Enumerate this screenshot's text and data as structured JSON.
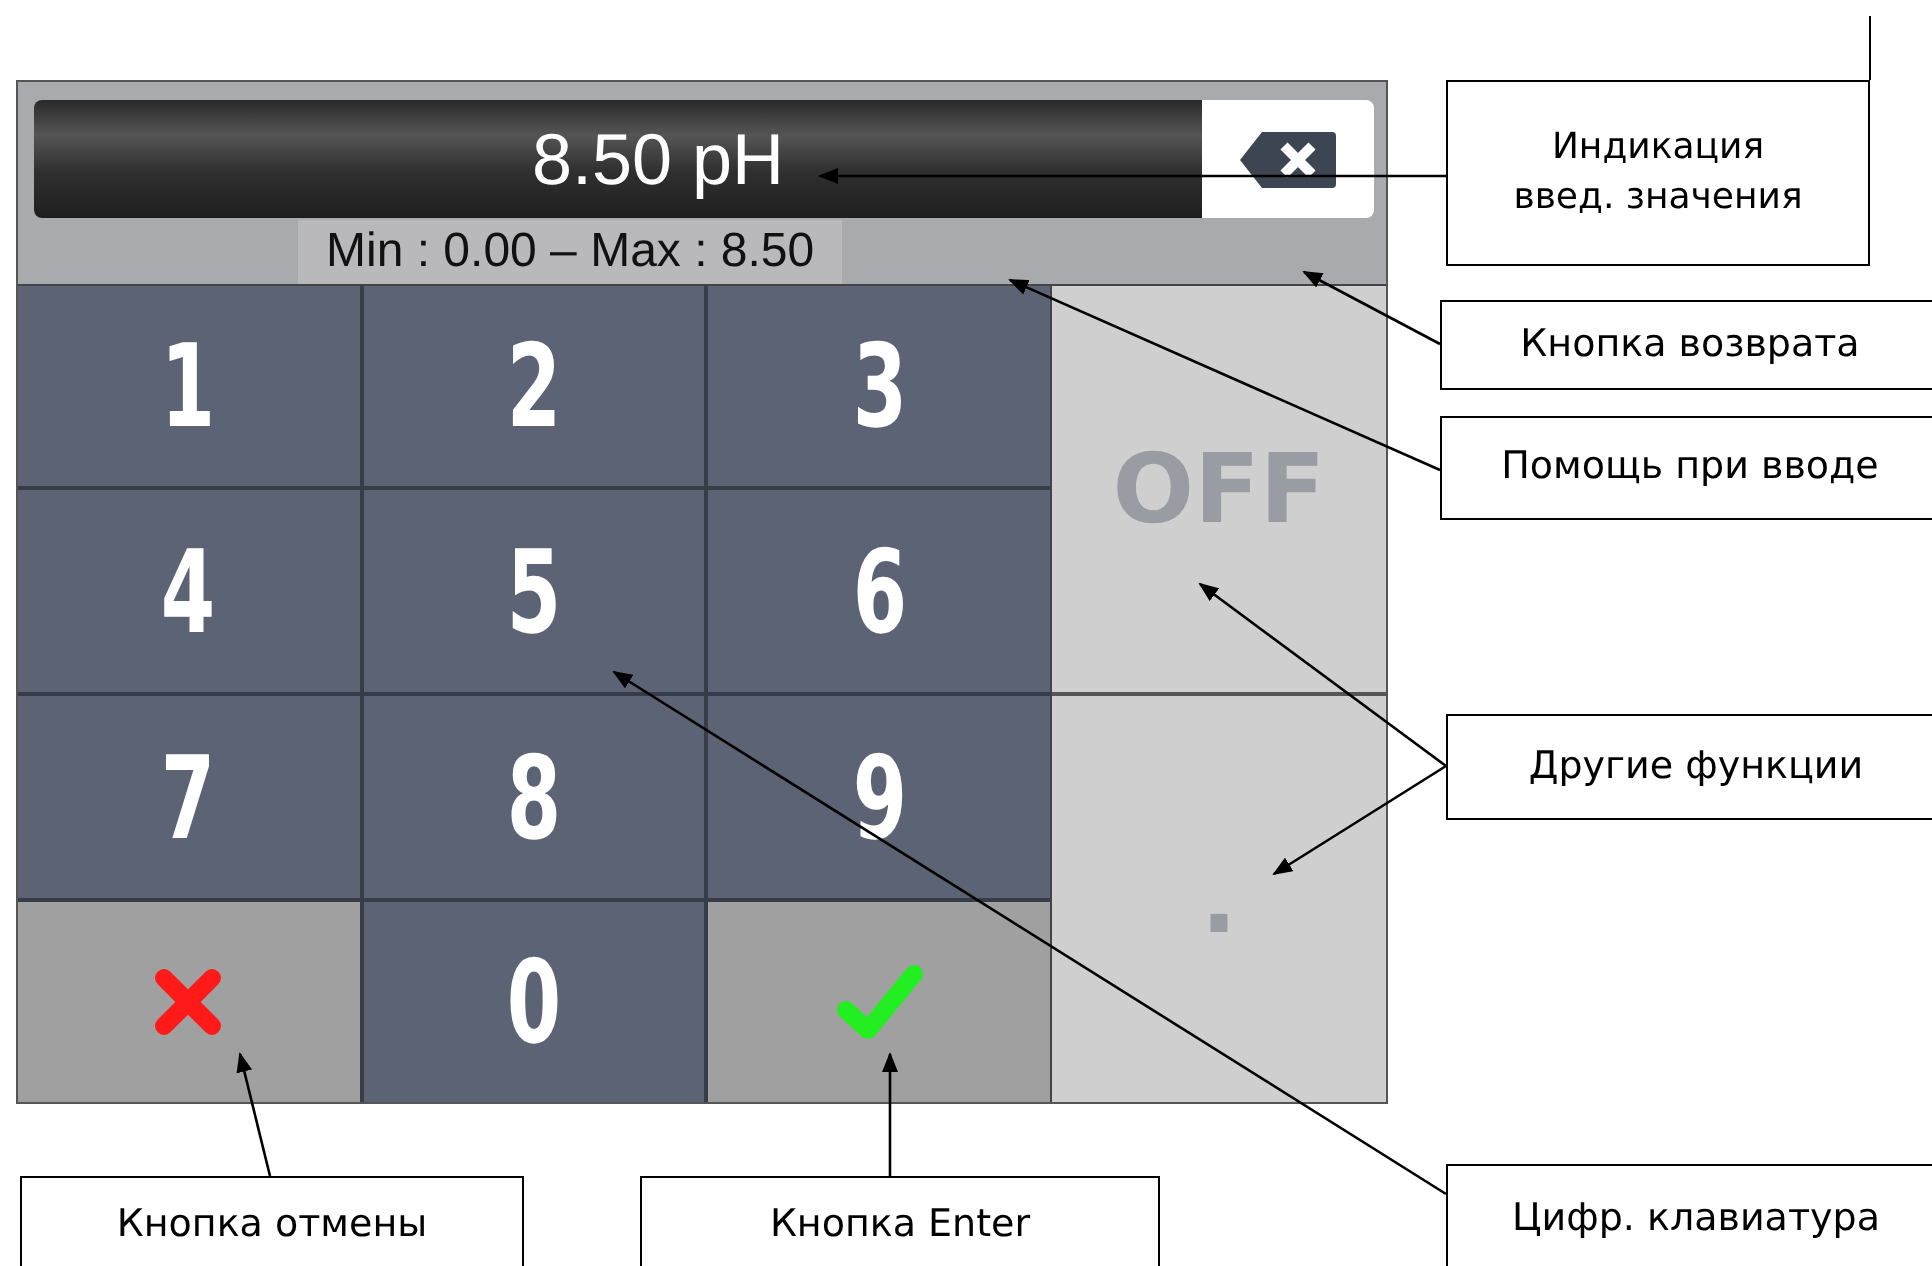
{
  "display": {
    "value": "8.50 pH",
    "range": "Min : 0.00 – Max : 8.50"
  },
  "keys": [
    {
      "kind": "digit",
      "label": "1"
    },
    {
      "kind": "digit",
      "label": "2"
    },
    {
      "kind": "digit",
      "label": "3"
    },
    {
      "kind": "digit",
      "label": "4"
    },
    {
      "kind": "digit",
      "label": "5"
    },
    {
      "kind": "digit",
      "label": "6"
    },
    {
      "kind": "digit",
      "label": "7"
    },
    {
      "kind": "digit",
      "label": "8"
    },
    {
      "kind": "digit",
      "label": "9"
    },
    {
      "kind": "cancel"
    },
    {
      "kind": "digit",
      "label": "0"
    },
    {
      "kind": "enter"
    }
  ],
  "side_keys": [
    {
      "label": "OFF",
      "disabled": true
    },
    {
      "label": ".",
      "disabled": true
    }
  ],
  "callouts": [
    {
      "text": "Индикация введ. значения"
    },
    {
      "text": "Кнопка возврата"
    },
    {
      "text": "Помощь при вводе"
    },
    {
      "text": "Другие функции"
    },
    {
      "text": "Кнопка отмены"
    },
    {
      "text": "Кнопка Enter"
    },
    {
      "text": "Цифр. клавиатура"
    }
  ]
}
